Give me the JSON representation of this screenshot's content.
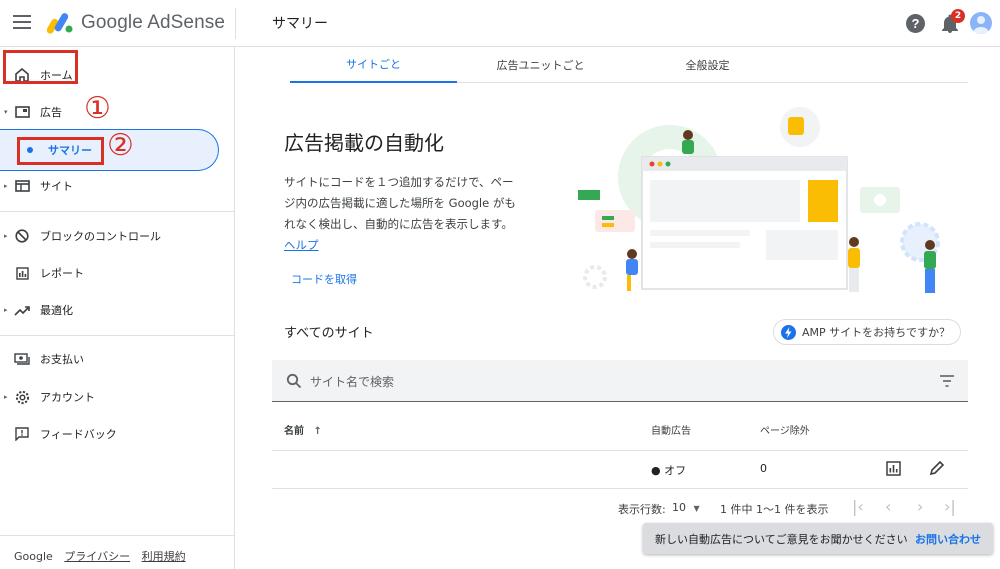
{
  "header": {
    "app_name": "Google AdSense",
    "page_title": "サマリー",
    "help_label": "?",
    "notification_count": "2"
  },
  "sidebar": {
    "items": [
      {
        "label": "ホーム",
        "icon": "home-icon"
      },
      {
        "label": "広告",
        "icon": "ad-icon"
      },
      {
        "label": "サマリー"
      },
      {
        "label": "サイト",
        "icon": "browser-icon"
      },
      {
        "label": "ブロックのコントロール",
        "icon": "block-icon"
      },
      {
        "label": "レポート",
        "icon": "bar-chart-icon"
      },
      {
        "label": "最適化",
        "icon": "trending-up-icon"
      },
      {
        "label": "お支払い",
        "icon": "payments-icon"
      },
      {
        "label": "アカウント",
        "icon": "gear-icon"
      },
      {
        "label": "フィードバック",
        "icon": "feedback-icon"
      }
    ],
    "annotations": {
      "marker1": "①",
      "marker2": "②"
    },
    "footer": {
      "brand": "Google",
      "privacy": "プライバシー",
      "terms": "利用規約"
    }
  },
  "tabs": [
    {
      "label": "サイトごと",
      "active": true
    },
    {
      "label": "広告ユニットごと",
      "active": false
    },
    {
      "label": "全般設定",
      "active": false
    }
  ],
  "hero": {
    "title": "広告掲載の自動化",
    "description": "サイトにコードを１つ追加するだけで、ページ内の広告掲載に適した場所を Google がもれなく検出し、自動的に広告を表示します。",
    "help_link": "ヘルプ",
    "get_code": "コードを取得"
  },
  "sites": {
    "heading": "すべてのサイト",
    "amp_chip": "AMP サイトをお持ちですか？",
    "search_placeholder": "サイト名で検索",
    "columns": {
      "name": "名前",
      "sort_arrow": "↑",
      "auto_ads": "自動広告",
      "excluded": "ページ除外"
    },
    "rows": [
      {
        "name": "",
        "auto_ads": "● オフ",
        "excluded": "0"
      }
    ],
    "pagination": {
      "rows_label": "表示行数:",
      "rows_value": "10",
      "range": "1 件中 1〜1 件を表示"
    }
  },
  "snackbar": {
    "message": "新しい自動広告についてご意見をお聞かせください",
    "action": "お問い合わせ"
  },
  "colors": {
    "accent": "#1a73e8",
    "annotation_red": "#d93025",
    "selected_bg": "#e8f0fe"
  }
}
